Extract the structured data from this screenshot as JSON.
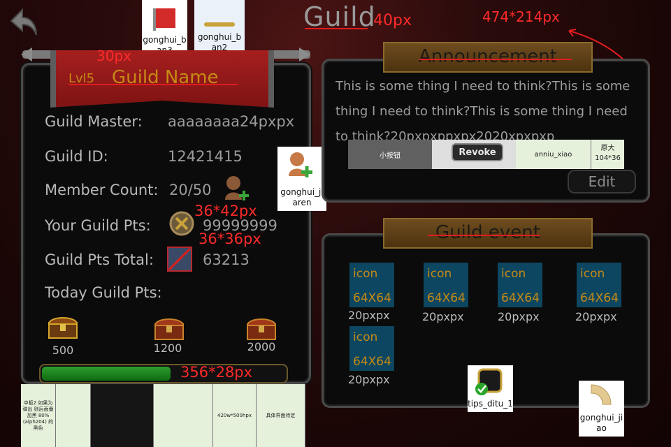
{
  "header": {
    "title": "Guild",
    "title_note": "40px",
    "size_note": "474*214px"
  },
  "placeholders": {
    "ban3": "gonghui_b\nan3",
    "ban2": "gonghui_b\nan2",
    "jiaren": "gonghui_ji\naren",
    "tips": "tips_ditu_1",
    "jiao": "gonghui_ji\nao"
  },
  "banner": {
    "note": "30px",
    "level": "Lvl5",
    "name": "Guild Name"
  },
  "info": {
    "master_label": "Guild Master:",
    "master_value": "aaaaaaaa24pxpx",
    "id_label": "Guild ID:",
    "id_value": "12421415",
    "member_label": "Member Count:",
    "member_value": "20/50",
    "your_pts_label": "Your Guild Pts:",
    "your_pts_value": "99999999",
    "your_pts_note": "36*42px",
    "total_label": "Guild Pts Total:",
    "total_value": "63213",
    "total_note": "36*36px",
    "today_label": "Today Guild Pts:"
  },
  "chests": [
    {
      "label": "500"
    },
    {
      "label": "1200"
    },
    {
      "label": "2000"
    }
  ],
  "progress": {
    "fraction": 0.53,
    "note": "356*28px"
  },
  "annotation_strip": {
    "col1": "中板2 如果为弹出 则后面叠加黑 80%(alph204) 的 黑色",
    "col5": "420w*500hpx",
    "col6": "具体界面待定"
  },
  "announcement": {
    "title": "Announcement",
    "text_line1": "This is some thing I need to think?This is some",
    "text_line2": "thing I need to think?This is some thing I need",
    "text_line3": "to think?20pxpxppxpx2020xpxpxp",
    "btn_xiao": "小按钮",
    "btn_revoke": "Revoke",
    "btn_anniu": "anniu_xiao",
    "btn_yuan_1": "原大",
    "btn_yuan_2": "104*36",
    "btn_edit": "Edit"
  },
  "event": {
    "title": "Guild event",
    "items": [
      {
        "l1": "icon",
        "l2": "64X64",
        "label": "20pxpx"
      },
      {
        "l1": "icon",
        "l2": "64X64",
        "label": "20pxpx"
      },
      {
        "l1": "icon",
        "l2": "64X64",
        "label": "20pxpx"
      },
      {
        "l1": "icon",
        "l2": "64X64",
        "label": "20pxpx"
      },
      {
        "l1": "icon",
        "l2": "64X64",
        "label": "20pxpx"
      }
    ]
  },
  "colors": {
    "accent_gold": "#c58a15",
    "annotation_red": "#ff2a2a",
    "progress_green": "#2e9d2e",
    "icon_blue": "#0d4660"
  }
}
